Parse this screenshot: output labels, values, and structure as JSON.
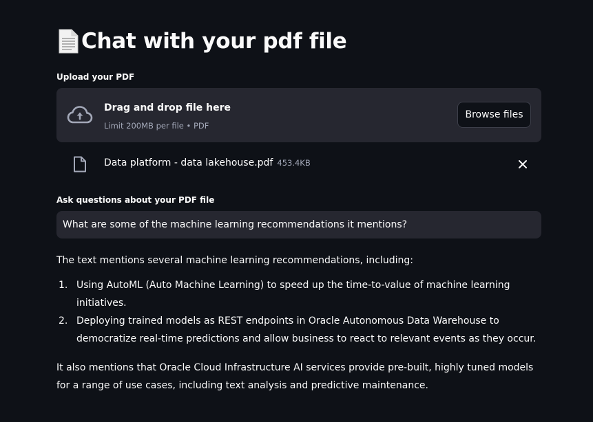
{
  "app": {
    "title": "Chat with your pdf file"
  },
  "uploader": {
    "label": "Upload your PDF",
    "drag_text": "Drag and drop file here",
    "limit_text": "Limit 200MB per file • PDF",
    "browse_label": "Browse files",
    "file": {
      "name": "Data platform - data lakehouse.pdf",
      "size": "453.4KB"
    }
  },
  "question": {
    "label": "Ask questions about your PDF file",
    "value": "What are some of the machine learning recommendations it mentions?"
  },
  "answer": {
    "intro": "The text mentions several machine learning recommendations, including:",
    "items": [
      {
        "num": "1.",
        "text": "Using AutoML (Auto Machine Learning) to speed up the time-to-value of machine learning initiatives."
      },
      {
        "num": "2.",
        "text": "Deploying trained models as REST endpoints in Oracle Autonomous Data Warehouse to democratize real-time predictions and allow business to react to relevant events as they occur."
      }
    ],
    "outro": "It also mentions that Oracle Cloud Infrastructure AI services provide pre-built, highly tuned models for a range of use cases, including text analysis and predictive maintenance."
  },
  "theme": {
    "background": "#0e1117",
    "surface": "#262730",
    "text": "#fafafa",
    "muted": "#a3a8b8"
  }
}
